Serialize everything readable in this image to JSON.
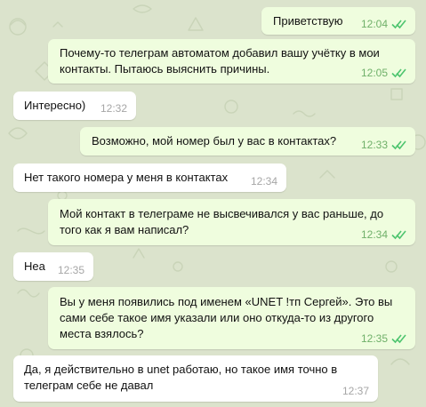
{
  "theme": {
    "background": "#dbe3cc",
    "outgoing_bubble": "#effdde",
    "incoming_bubble": "#ffffff",
    "outgoing_time": "#6fb069",
    "read_check": "#4ec56f",
    "incoming_time": "#a6a6a6"
  },
  "messages": [
    {
      "direction": "out",
      "lines": [
        "Приветствую"
      ],
      "time": "12:04",
      "status": "read"
    },
    {
      "direction": "out",
      "lines": [
        "Почему-то телеграм автоматом добавил вашу учётку в мои",
        "контакты. Пытаюсь выяснить причины."
      ],
      "time": "12:05",
      "status": "read"
    },
    {
      "direction": "in",
      "lines": [
        "Интересно)"
      ],
      "time": "12:32"
    },
    {
      "direction": "out",
      "lines": [
        "Возможно, мой номер был у вас в контактах?"
      ],
      "time": "12:33",
      "status": "read"
    },
    {
      "direction": "in",
      "lines": [
        "Нет такого номера у меня в контактах"
      ],
      "time": "12:34"
    },
    {
      "direction": "out",
      "lines": [
        "Мой контакт в телеграме не высвечивался у вас раньше, до",
        "того как я вам написал?"
      ],
      "time": "12:34",
      "status": "read"
    },
    {
      "direction": "in",
      "lines": [
        "Неа"
      ],
      "time": "12:35"
    },
    {
      "direction": "out",
      "lines": [
        "Вы у меня появились под именем «UNET !тп Сергей». Это вы",
        "сами себе такое имя указали или оно откуда-то из другого",
        "места взялось?"
      ],
      "time": "12:35",
      "status": "read"
    },
    {
      "direction": "in",
      "lines": [
        "Да,  я действительно в unet работаю, но такое имя точно в",
        "телеграм себе не давал"
      ],
      "time": "12:37"
    }
  ]
}
